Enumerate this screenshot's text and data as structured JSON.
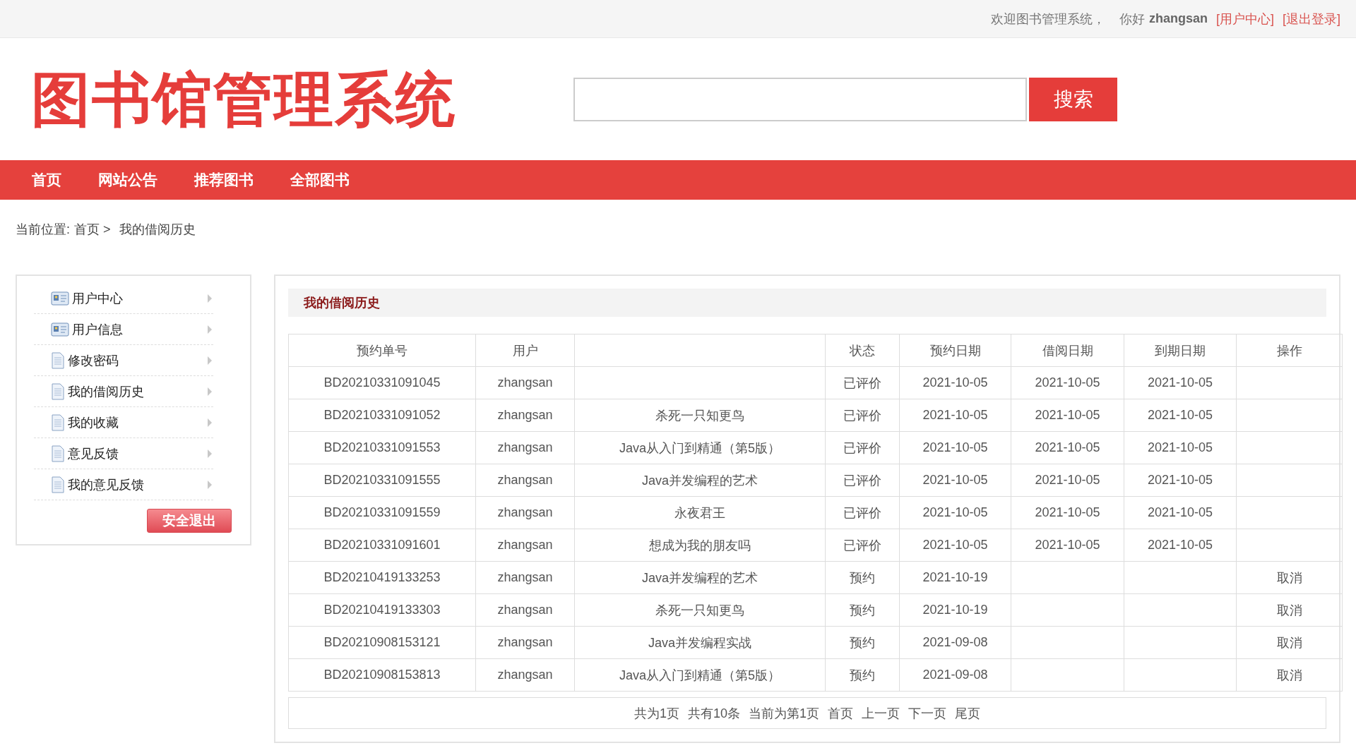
{
  "top_bar": {
    "welcome": "欢迎图书管理系统，",
    "greeting": "你好",
    "username": "zhangsan",
    "links": [
      "[用户中心]",
      "[退出登录]"
    ]
  },
  "logo": "图书馆管理系统",
  "search": {
    "button": "搜索"
  },
  "nav": [
    "首页",
    "网站公告",
    "推荐图书",
    "全部图书"
  ],
  "breadcrumb": {
    "label": "当前位置:",
    "home": "首页 >",
    "current": "我的借阅历史"
  },
  "sidebar": {
    "items": [
      {
        "label": "用户中心",
        "kind": "card"
      },
      {
        "label": "用户信息",
        "kind": "card"
      },
      {
        "label": "修改密码",
        "kind": "doc"
      },
      {
        "label": "我的借阅历史",
        "kind": "doc"
      },
      {
        "label": "我的收藏",
        "kind": "doc"
      },
      {
        "label": "意见反馈",
        "kind": "doc"
      },
      {
        "label": "我的意见反馈",
        "kind": "doc"
      }
    ],
    "logout": "安全退出"
  },
  "panel": {
    "title": "我的借阅历史",
    "columns": [
      {
        "label": "预约单号"
      },
      {
        "label": "用户"
      },
      {},
      {
        "label": "状态"
      },
      {
        "label": "预约日期"
      },
      {
        "label": "借阅日期"
      },
      {
        "label": "到期日期"
      },
      {
        "label": "操作"
      }
    ],
    "rows": [
      {
        "order": "BD20210331091045",
        "user": "zhangsan",
        "status": "已评价",
        "reserve_date": "2021-10-05",
        "borrow_date": "2021-10-05",
        "due_date": "2021-10-05"
      },
      {
        "order": "BD20210331091052",
        "user": "zhangsan",
        "title": "杀死一只知更鸟",
        "status": "已评价",
        "reserve_date": "2021-10-05",
        "borrow_date": "2021-10-05",
        "due_date": "2021-10-05"
      },
      {
        "order": "BD20210331091553",
        "user": "zhangsan",
        "title": "Java从入门到精通（第5版）",
        "status": "已评价",
        "reserve_date": "2021-10-05",
        "borrow_date": "2021-10-05",
        "due_date": "2021-10-05"
      },
      {
        "order": "BD20210331091555",
        "user": "zhangsan",
        "title": "Java并发编程的艺术",
        "status": "已评价",
        "reserve_date": "2021-10-05",
        "borrow_date": "2021-10-05",
        "due_date": "2021-10-05"
      },
      {
        "order": "BD20210331091559",
        "user": "zhangsan",
        "title": "永夜君王",
        "status": "已评价",
        "reserve_date": "2021-10-05",
        "borrow_date": "2021-10-05",
        "due_date": "2021-10-05"
      },
      {
        "order": "BD20210331091601",
        "user": "zhangsan",
        "title": "想成为我的朋友吗",
        "status": "已评价",
        "reserve_date": "2021-10-05",
        "borrow_date": "2021-10-05",
        "due_date": "2021-10-05"
      },
      {
        "order": "BD20210419133253",
        "user": "zhangsan",
        "title": "Java并发编程的艺术",
        "status": "预约",
        "reserve_date": "2021-10-19",
        "action": "取消"
      },
      {
        "order": "BD20210419133303",
        "user": "zhangsan",
        "title": "杀死一只知更鸟",
        "status": "预约",
        "reserve_date": "2021-10-19",
        "action": "取消"
      },
      {
        "order": "BD20210908153121",
        "user": "zhangsan",
        "title": "Java并发编程实战",
        "status": "预约",
        "reserve_date": "2021-09-08",
        "action": "取消"
      },
      {
        "order": "BD20210908153813",
        "user": "zhangsan",
        "title": "Java从入门到精通（第5版）",
        "status": "预约",
        "reserve_date": "2021-09-08",
        "action": "取消"
      }
    ],
    "pagination": {
      "info": [
        "共为1页",
        "共有10条",
        "当前为第1页"
      ],
      "links": [
        "首页",
        "上一页",
        "下一页",
        "尾页"
      ]
    }
  }
}
